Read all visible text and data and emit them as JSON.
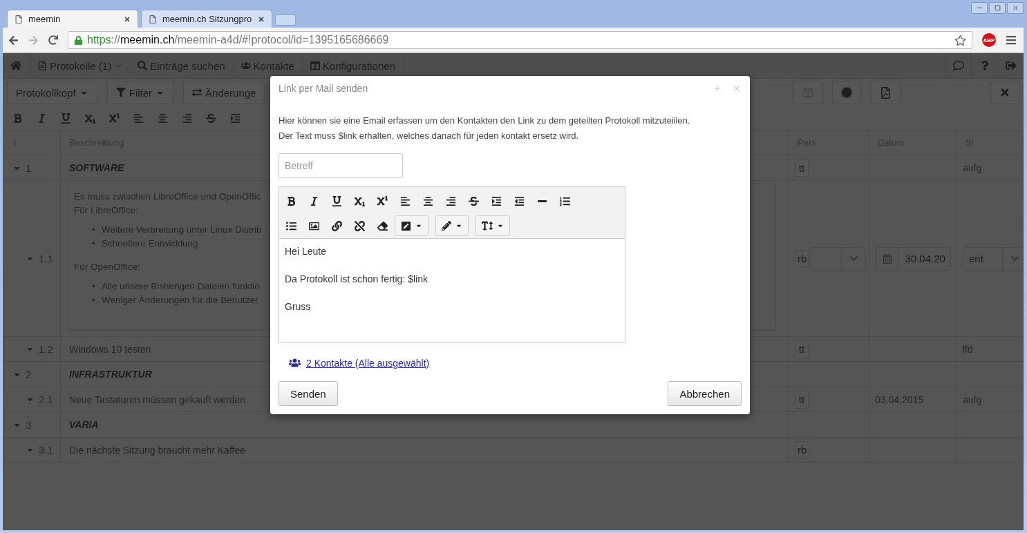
{
  "browser": {
    "tabs": [
      {
        "title": "meemin",
        "selected": true
      },
      {
        "title": "meemin.ch Sitzungpro",
        "selected": false
      }
    ],
    "url": {
      "scheme": "https",
      "separator": "://",
      "host": "meemin.ch",
      "path": "/meemin-a4d/#!protocol/id=1395165686669"
    },
    "extension_badge": "ABP"
  },
  "navbar": {
    "items": [
      {
        "label": "Protokolle (1)",
        "dropdown": true
      },
      {
        "label": "Einträge suchen",
        "dropdown": false
      },
      {
        "label": "Kontakte",
        "dropdown": false
      },
      {
        "label": "Konfigurationen",
        "dropdown": false
      }
    ]
  },
  "toolbar": {
    "buttons": [
      {
        "label": "Protokollkopf",
        "dropdown": true
      },
      {
        "label": "Filter",
        "dropdown": true
      },
      {
        "label": "Änderunge",
        "dropdown": false
      }
    ],
    "save_disabled": true
  },
  "table": {
    "columns": [
      "I",
      "Beschreibung",
      "Pers",
      "Datum",
      "St"
    ],
    "rows": [
      {
        "kind": "section",
        "number": "1",
        "title": "SOFTWARE",
        "pers": "tt",
        "status": "aufg",
        "expanded": true,
        "children": [
          {
            "kind": "editing",
            "number": "1.1",
            "expanded": true,
            "description": [
              {
                "kind": "paragraph",
                "lines": [
                  "Es muss zwischen LibreOffice und OpenOffic",
                  "Für LibreOffice:"
                ]
              },
              {
                "kind": "list",
                "marker": "•",
                "items": [
                  "Weitere Verbreitung unter Linux Distrib",
                  "Schnellere Entwicklung"
                ]
              },
              {
                "kind": "paragraph",
                "lines": [
                  "Für OpenOffice:"
                ]
              },
              {
                "kind": "list",
                "marker": "•",
                "items": [
                  "Alle unsere Bisherigen Dateien funktio",
                  "Weniger Änderungen für die Benutzer"
                ]
              }
            ],
            "pers": "rb",
            "date": "30.04.20",
            "status": "ent"
          },
          {
            "kind": "item",
            "number": "1.2",
            "text": "Windows 10 testen",
            "pers": "tt",
            "status": "lfd",
            "expanded": true
          }
        ]
      },
      {
        "kind": "section",
        "number": "2",
        "title": "INFRASTRUKTUR",
        "expanded": true,
        "children": [
          {
            "kind": "item",
            "number": "2.1",
            "text": "Neue Tastaturen müssen gekauft werden.",
            "pers": "tt",
            "date": "03.04.2015",
            "status": "aufg",
            "expanded": true
          }
        ]
      },
      {
        "kind": "section",
        "number": "3",
        "title": "VARIA",
        "expanded": true,
        "children": [
          {
            "kind": "item",
            "number": "3.1",
            "text": "Die nächste Sitzung braucht mehr Kaffee",
            "pers": "rb",
            "expanded": true
          }
        ]
      }
    ]
  },
  "dialog": {
    "title": "Link per Mail senden",
    "intro": [
      "Hier können sie eine Email erfassen um den Kontakten den Link zu dem geteilten Protokoll mitzuteiilen.",
      "Der Text muss $link erhalten, welches danach für jeden kontakt ersetz wird."
    ],
    "subject": {
      "placeholder": "Betreff"
    },
    "body": [
      "Hei Leute",
      "Da Protokoll ist schon fertig: $link",
      "Gruss"
    ],
    "contacts_link": "2 Kontakte (Alle ausgewählt)",
    "buttons": [
      "Senden",
      "Abbrechen"
    ]
  }
}
